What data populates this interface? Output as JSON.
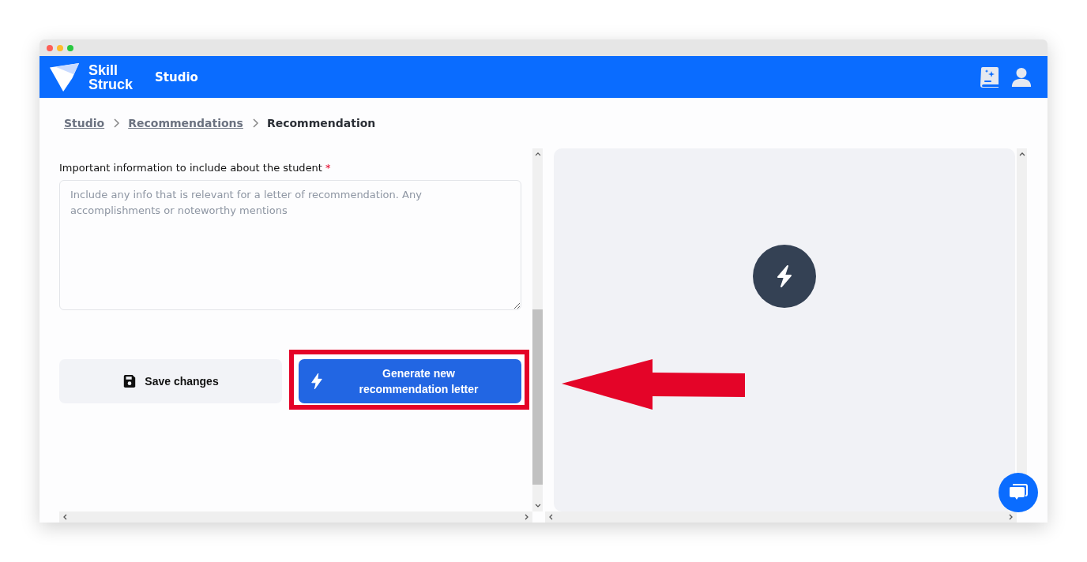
{
  "header": {
    "logo_line1": "Skill",
    "logo_line2": "Struck",
    "section": "Studio"
  },
  "breadcrumb": [
    {
      "label": "Studio",
      "link": true
    },
    {
      "label": "Recommendations",
      "link": true
    },
    {
      "label": "Recommendation",
      "link": false
    }
  ],
  "form": {
    "label": "Important information to include about the student",
    "required_mark": "*",
    "placeholder": "Include any info that is relevant for a letter of recommendation. Any accomplishments or noteworthy mentions"
  },
  "buttons": [
    {
      "kind": "secondary",
      "label": "Save changes",
      "highlighted": false
    },
    {
      "kind": "primary",
      "label": "Generate new recommendation letter",
      "highlighted": true
    }
  ]
}
